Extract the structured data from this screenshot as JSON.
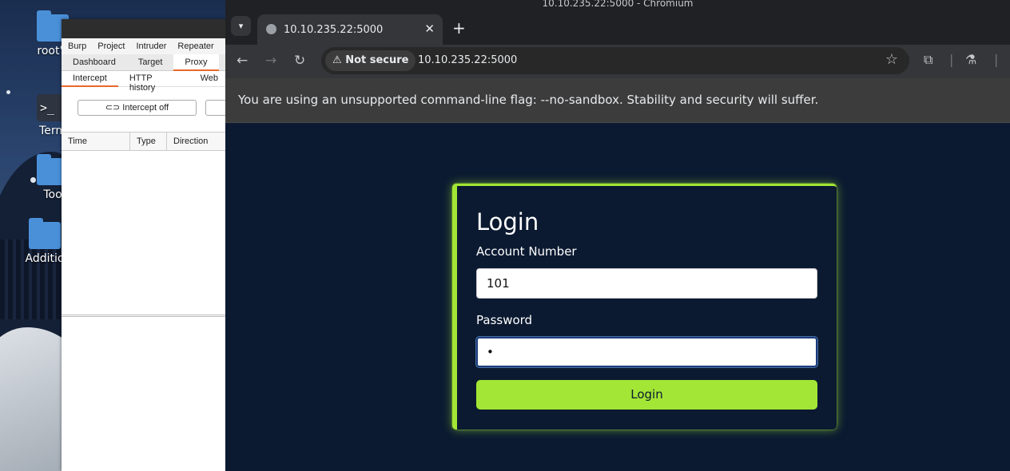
{
  "desktop": {
    "icons": [
      {
        "label": "root's"
      },
      {
        "label": "Term"
      },
      {
        "label": "Too"
      },
      {
        "label": "Additio"
      }
    ]
  },
  "burp": {
    "menu": [
      "Burp",
      "Project",
      "Intruder",
      "Repeater"
    ],
    "tabs": [
      "Dashboard",
      "Target",
      "Proxy"
    ],
    "active_tab": "Proxy",
    "subtabs": [
      "Intercept",
      "HTTP history",
      "Web"
    ],
    "intercept_button": "Intercept off",
    "columns": [
      "Time",
      "Type",
      "Direction"
    ]
  },
  "browser": {
    "window_title": "10.10.235.22:5000 - Chromium",
    "tab_title": "10.10.235.22:5000",
    "security_chip": "Not secure",
    "url": "10.10.235.22:5000",
    "infobar_text": "You are using an unsupported command-line flag: --no-sandbox. Stability and security will suffer."
  },
  "login": {
    "title": "Login",
    "account_label": "Account Number",
    "account_value": "101",
    "password_label": "Password",
    "password_value": "•",
    "button_label": "Login"
  },
  "colors": {
    "accent": "#a3e635",
    "page_bg": "#0b1a31"
  }
}
